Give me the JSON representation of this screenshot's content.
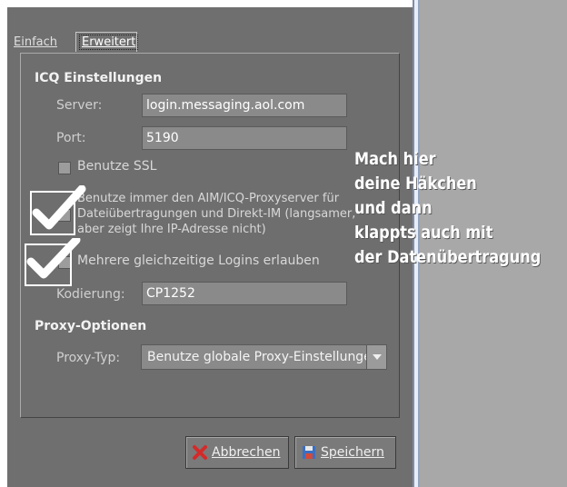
{
  "tabs": [
    {
      "label": "Einfach"
    },
    {
      "label": "Erweitert"
    }
  ],
  "icq": {
    "section_title": "ICQ Einstellungen",
    "server_label": "Server:",
    "server_value": "login.messaging.aol.com",
    "port_label": "Port:",
    "port_value": "5190",
    "ssl_label": "Benutze SSL",
    "proxy_server_label_line1": "Benutze immer den AIM/ICQ-Proxyserver für",
    "proxy_server_label_line2": "Dateiübertragungen und Direkt-IM (langsamer,",
    "proxy_server_label_line3": "aber zeigt Ihre IP-Adresse nicht)",
    "multi_login_label": "Mehrere gleichzeitige Logins erlauben",
    "encoding_label": "Kodierung:",
    "encoding_value": "CP1252"
  },
  "proxy": {
    "section_title": "Proxy-Optionen",
    "type_label": "Proxy-Typ:",
    "type_value": "Benutze globale Proxy-Einstellungen"
  },
  "buttons": {
    "cancel_label": "Abbrechen",
    "save_label": "Speichern"
  },
  "overlay_text": {
    "line1": "Mach hier",
    "line2": "deine Häkchen",
    "line3": "und dann",
    "line4": "klappts auch mit",
    "line5": "der Datenübertragung"
  },
  "colors": {
    "dialog_bg": "#6f6f6f",
    "right_pane_bg": "#a8a8a8",
    "annotation_text": "#ffffff",
    "cancel_icon": "#d42a2a",
    "save_icon": "#3a6fc4"
  },
  "icons": [
    "checkmark-annotation-icon",
    "cancel-x-icon",
    "save-disk-icon",
    "chevron-down-icon"
  ]
}
